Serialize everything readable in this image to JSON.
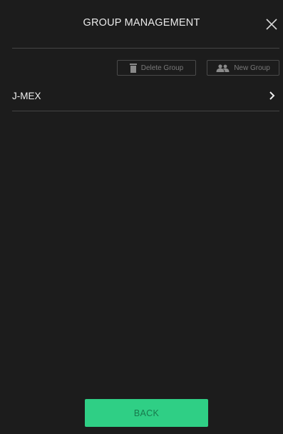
{
  "header": {
    "title": "GROUP MANAGEMENT",
    "close_icon": "close-icon"
  },
  "toolbar": {
    "delete_label": "Delete Group",
    "delete_icon": "trash-icon",
    "new_label": "New Group",
    "new_icon": "users-icon"
  },
  "groups": [
    {
      "name": "J-MEX",
      "icon": "chevron-right-icon"
    }
  ],
  "footer": {
    "back_label": "BACK"
  },
  "colors": {
    "background": "#1c1c1c",
    "accent": "#2fcf85",
    "divider": "#444444",
    "muted_text": "#7a7a7a"
  }
}
